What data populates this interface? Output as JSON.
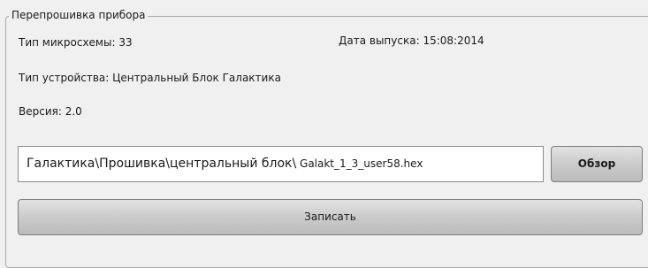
{
  "group": {
    "title": "Перепрошивка прибора"
  },
  "info": {
    "chip_type": "Тип микросхемы: 33",
    "release_date": "Дата выпуска: 15:08:2014",
    "device_type": "Тип устройства: Центральный Блок Галактика",
    "version": "Версия: 2.0"
  },
  "firmware": {
    "path_dir": "Галактика\\Прошивка\\центральный блок\\",
    "path_file": " Galakt_1_3_user58.hex",
    "browse_label": "Обзор",
    "write_label": "Записать"
  }
}
